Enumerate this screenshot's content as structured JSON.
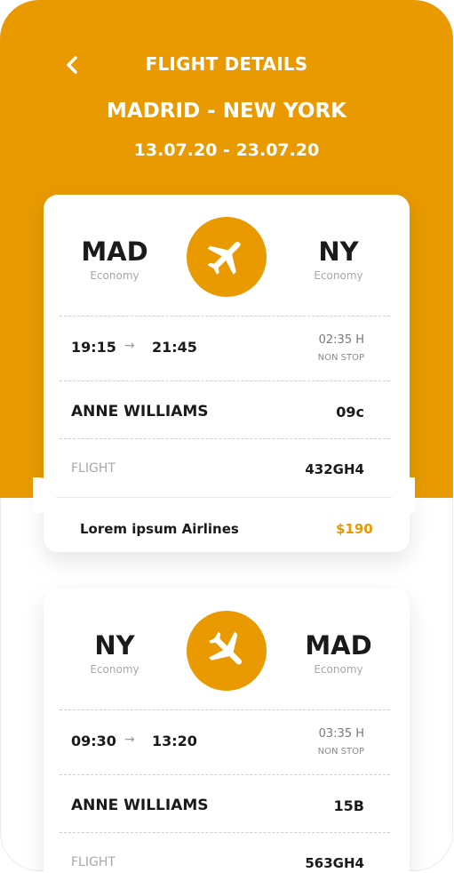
{
  "header": {
    "title": "FLIGHT DETAILS",
    "route": "MADRID - NEW YORK",
    "dates": "13.07.20 - 23.07.20",
    "back_icon": "chevron-left-icon"
  },
  "colors": {
    "accent": "#e89a00",
    "text": "#1a1a1a",
    "muted": "#a8a8a8"
  },
  "tickets": [
    {
      "from_code": "MAD",
      "from_class": "Economy",
      "to_code": "NY",
      "to_class": "Economy",
      "plane_icon": "airplane-icon",
      "depart_time": "19:15",
      "arrow": "→",
      "arrive_time": "21:45",
      "duration": "02:35 H",
      "stops": "NON STOP",
      "passenger": "ANNE WILLIAMS",
      "seat": "09c",
      "flight_label": "FLIGHT",
      "flight_number": "432GH4",
      "airline": "Lorem ipsum Airlines",
      "price": "$190"
    },
    {
      "from_code": "NY",
      "from_class": "Economy",
      "to_code": "MAD",
      "to_class": "Economy",
      "plane_icon": "airplane-landing-icon",
      "depart_time": "09:30",
      "arrow": "→",
      "arrive_time": "13:20",
      "duration": "03:35 H",
      "stops": "NON STOP",
      "passenger": "ANNE WILLIAMS",
      "seat": "15B",
      "flight_label": "FLIGHT",
      "flight_number": "563GH4"
    }
  ]
}
